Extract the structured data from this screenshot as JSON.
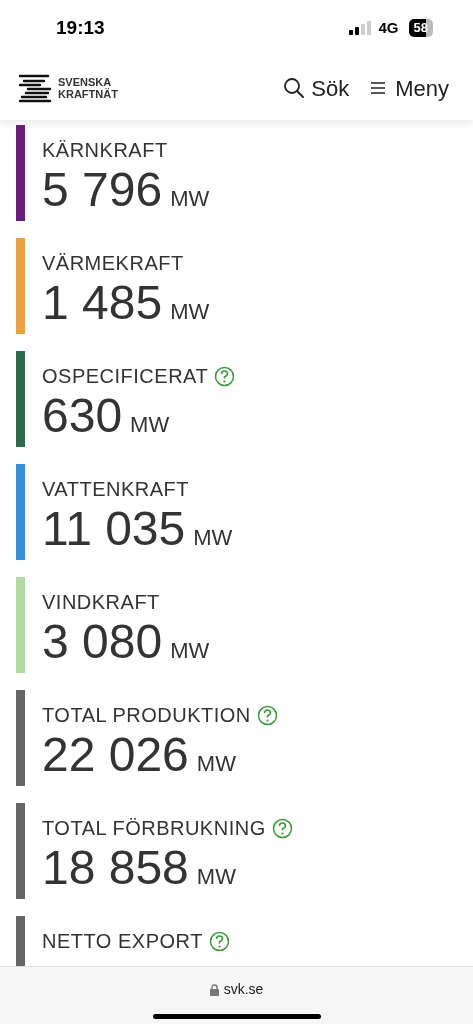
{
  "status_bar": {
    "time": "19:13",
    "network": "4G",
    "battery": "58"
  },
  "header": {
    "logo_line_1": "SVENSKA",
    "logo_line_2": "KRAFTNÄT",
    "search": "Sök",
    "menu": "Meny"
  },
  "items": [
    {
      "label": "KÄRNKRAFT",
      "value": "5 796",
      "unit": "MW",
      "color": "#6b1f7a",
      "help": false
    },
    {
      "label": "VÄRMEKRAFT",
      "value": "1 485",
      "unit": "MW",
      "color": "#e9a147",
      "help": false
    },
    {
      "label": "OSPECIFICERAT",
      "value": "630",
      "unit": "MW",
      "color": "#2e6b4a",
      "help": true
    },
    {
      "label": "VATTENKRAFT",
      "value": "11 035",
      "unit": "MW",
      "color": "#3a8ed8",
      "help": false
    },
    {
      "label": "VINDKRAFT",
      "value": "3 080",
      "unit": "MW",
      "color": "#b3d9a3",
      "help": false
    },
    {
      "label": "TOTAL PRODUKTION",
      "value": "22 026",
      "unit": "MW",
      "color": "#666666",
      "help": true
    },
    {
      "label": "TOTAL FÖRBRUKNING",
      "value": "18 858",
      "unit": "MW",
      "color": "#666666",
      "help": true
    },
    {
      "label": "NETTO EXPORT",
      "color": "#666666",
      "help": true
    }
  ],
  "browser": {
    "url": "svk.se"
  }
}
